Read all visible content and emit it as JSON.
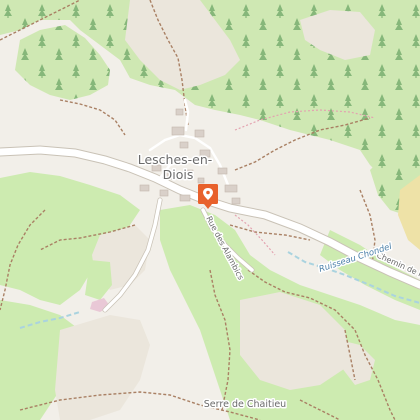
{
  "map": {
    "labels": {
      "village": "Lesches-en-Diois",
      "village_line1": "Lesches-en-",
      "village_line2": "Diois",
      "street_alambics": "Rue des Alambics",
      "road_chemin": "Chemin de l",
      "stream": "Ruisseau Chondel",
      "ridge": "Serre de Chaitieu"
    },
    "marker": {
      "label": "location-pin",
      "color": "#e8612c"
    },
    "colors": {
      "background": "#f2efe9",
      "forest": "#addd8e",
      "meadow": "#cdebb0",
      "road": "#ffffff",
      "path": "#a0734f",
      "water": "#aad3df",
      "stream_text": "#4a7fa8"
    }
  }
}
